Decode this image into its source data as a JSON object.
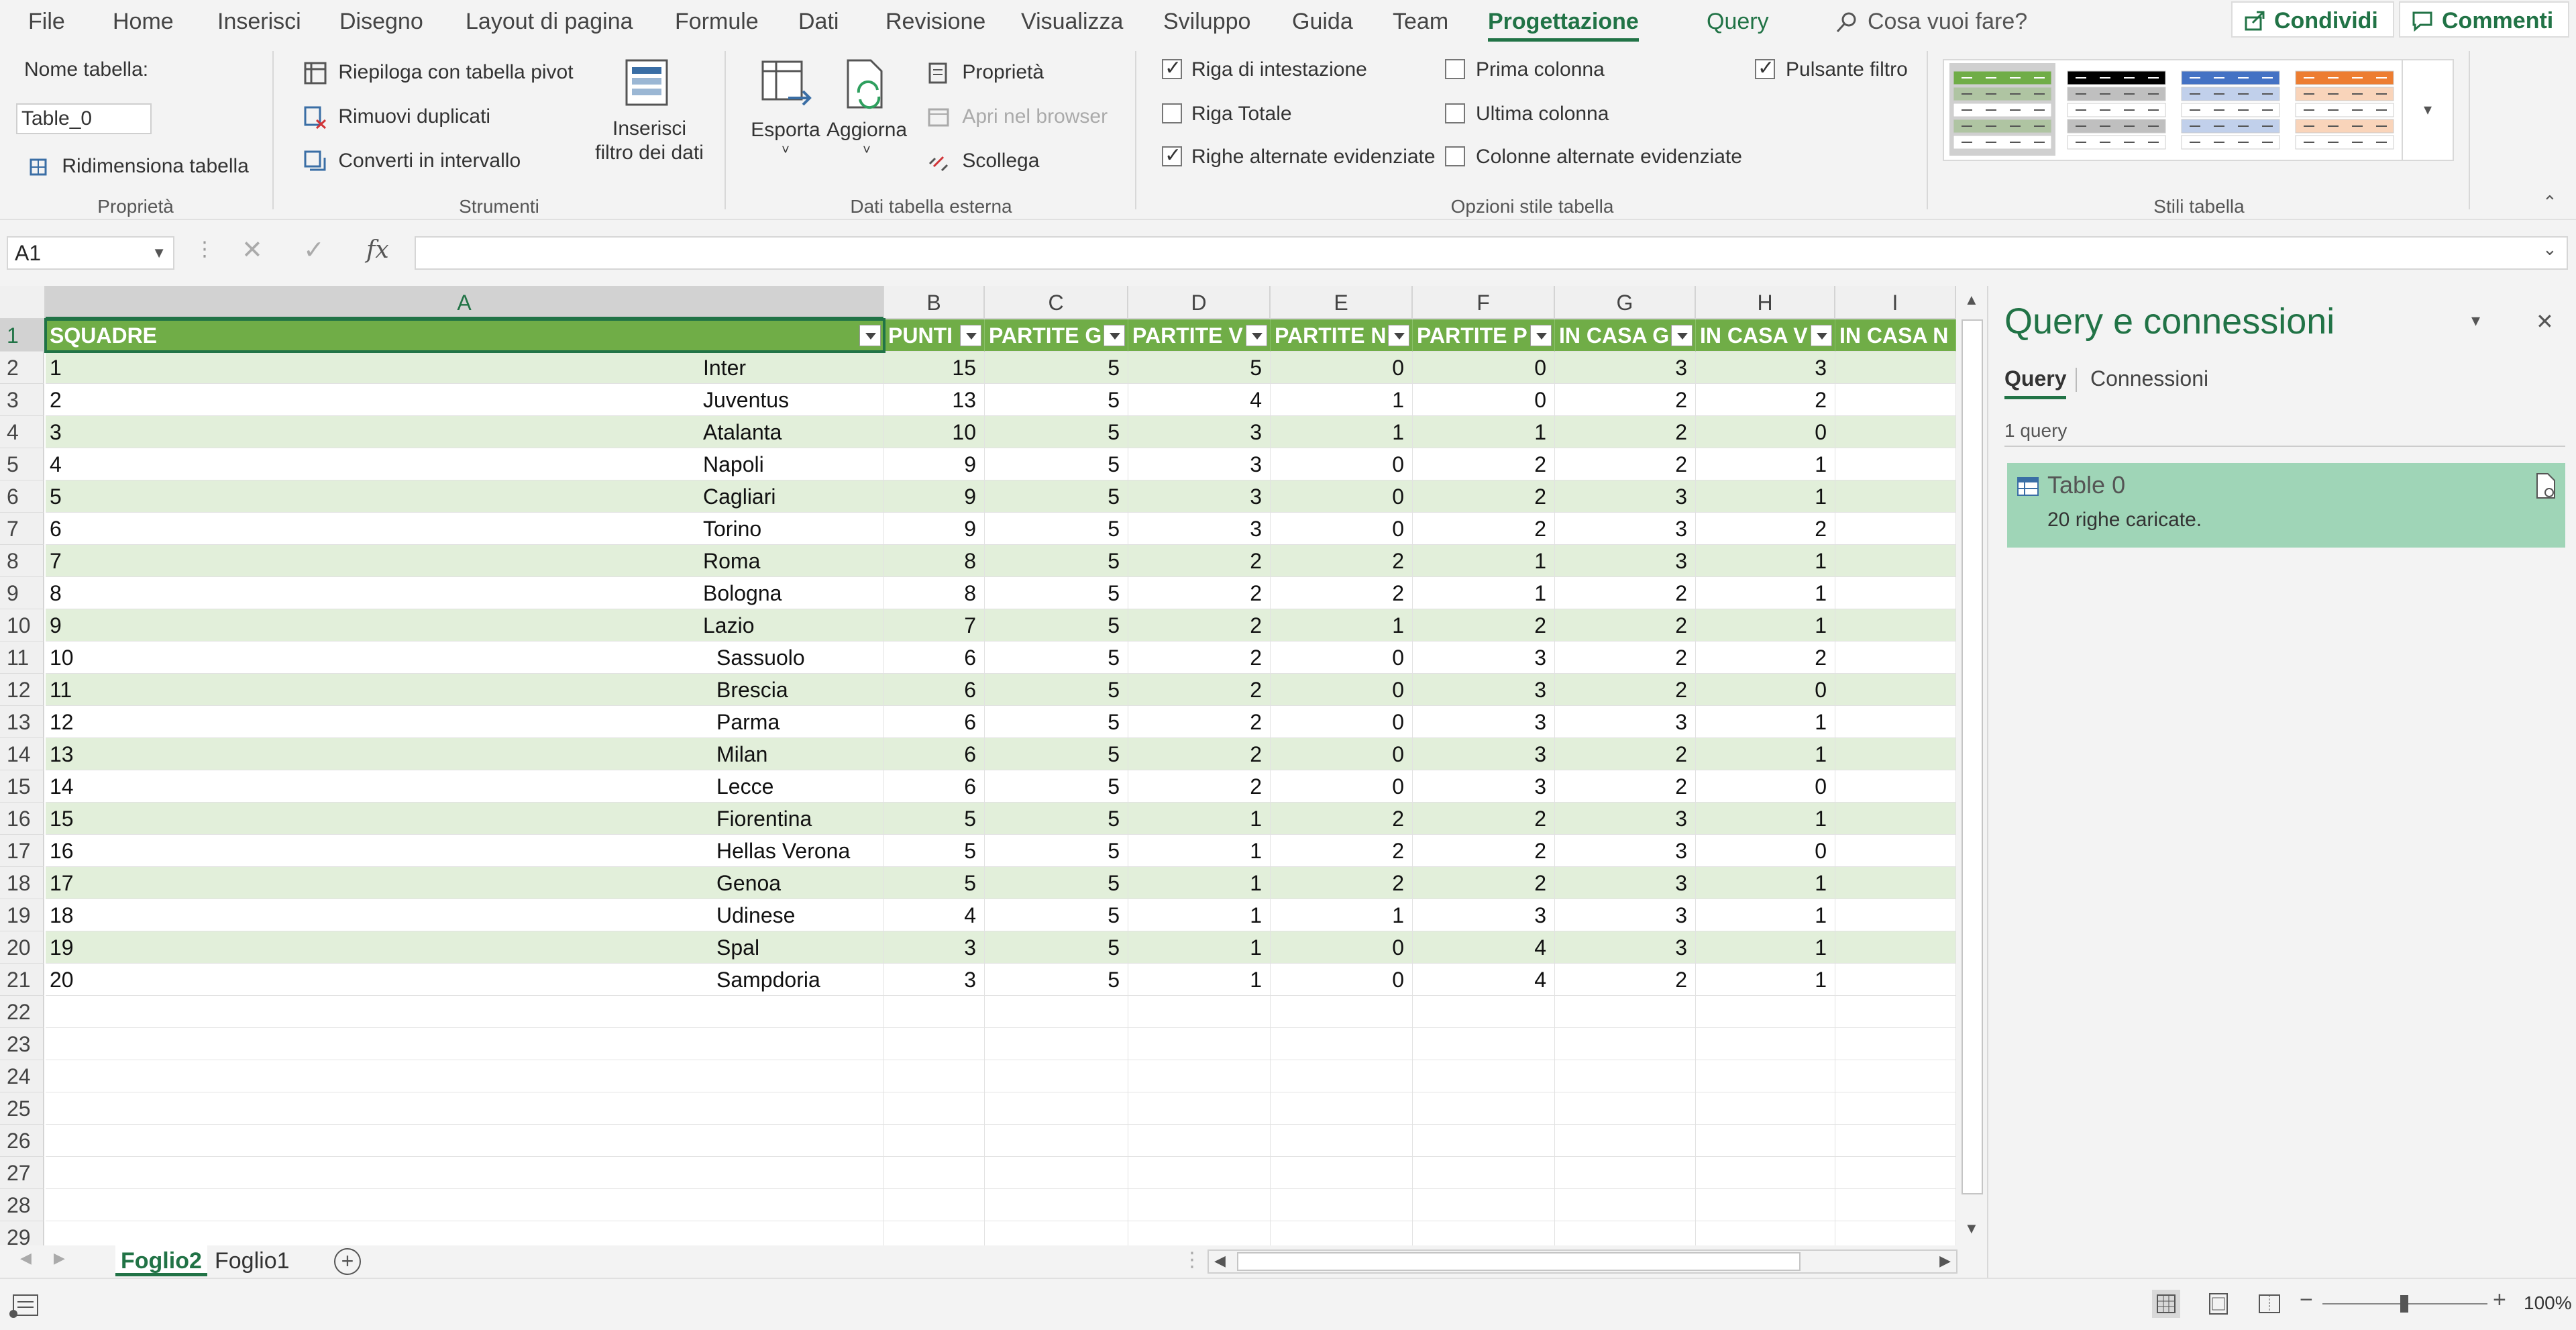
{
  "menu": {
    "items": [
      "File",
      "Home",
      "Inserisci",
      "Disegno",
      "Layout di pagina",
      "Formule",
      "Dati",
      "Revisione",
      "Visualizza",
      "Sviluppo",
      "Guida",
      "Team",
      "Progettazione",
      "Query"
    ],
    "search_placeholder": "Cosa vuoi fare?",
    "share_label": "Condividi",
    "comments_label": "Commenti"
  },
  "ribbon": {
    "properties": {
      "table_name_label": "Nome tabella:",
      "table_name_value": "Table_0",
      "resize_label": "Ridimensiona tabella",
      "group_label": "Proprietà"
    },
    "tools": {
      "pivot_label": "Riepiloga con tabella pivot",
      "remove_dup_label": "Rimuovi duplicati",
      "convert_label": "Converti in intervallo",
      "slicer_label_1": "Inserisci",
      "slicer_label_2": "filtro dei dati",
      "group_label": "Strumenti"
    },
    "external": {
      "export_label": "Esporta",
      "refresh_label": "Aggiorna",
      "props_label": "Proprietà",
      "open_browser_label": "Apri nel browser",
      "unlink_label": "Scollega",
      "group_label": "Dati tabella esterna"
    },
    "style_options": {
      "header_row": "Riga di intestazione",
      "total_row": "Riga Totale",
      "banded_rows": "Righe alternate evidenziate",
      "first_column": "Prima colonna",
      "last_column": "Ultima colonna",
      "banded_columns": "Colonne alternate evidenziate",
      "filter_button": "Pulsante filtro",
      "header_row_checked": true,
      "total_row_checked": false,
      "banded_rows_checked": true,
      "first_column_checked": false,
      "last_column_checked": false,
      "banded_columns_checked": false,
      "filter_button_checked": true,
      "group_label": "Opzioni stile tabella"
    },
    "styles": {
      "group_label": "Stili tabella",
      "swatches": [
        "#70ad47",
        "#000000",
        "#4472c4",
        "#ed7d31"
      ]
    }
  },
  "formula_bar": {
    "name_box": "A1",
    "fx_label": "fx",
    "value": ""
  },
  "grid": {
    "columns": [
      "A",
      "B",
      "C",
      "D",
      "E",
      "F",
      "G",
      "H",
      "I"
    ],
    "headers": [
      "SQUADRE",
      "PUNTI",
      "PARTITE G",
      "PARTITE V",
      "PARTITE N",
      "PARTITE P",
      "IN CASA G",
      "IN CASA V",
      "IN CASA N"
    ],
    "rows": [
      [
        "1",
        "Inter",
        "15",
        "5",
        "5",
        "0",
        "0",
        "3",
        "3"
      ],
      [
        "2",
        "Juventus",
        "13",
        "5",
        "4",
        "1",
        "0",
        "2",
        "2"
      ],
      [
        "3",
        "Atalanta",
        "10",
        "5",
        "3",
        "1",
        "1",
        "2",
        "0"
      ],
      [
        "4",
        "Napoli",
        "9",
        "5",
        "3",
        "0",
        "2",
        "2",
        "1"
      ],
      [
        "5",
        "Cagliari",
        "9",
        "5",
        "3",
        "0",
        "2",
        "3",
        "1"
      ],
      [
        "6",
        "Torino",
        "9",
        "5",
        "3",
        "0",
        "2",
        "3",
        "2"
      ],
      [
        "7",
        "Roma",
        "8",
        "5",
        "2",
        "2",
        "1",
        "3",
        "1"
      ],
      [
        "8",
        "Bologna",
        "8",
        "5",
        "2",
        "2",
        "1",
        "2",
        "1"
      ],
      [
        "9",
        "Lazio",
        "7",
        "5",
        "2",
        "1",
        "2",
        "2",
        "1"
      ],
      [
        "10",
        "Sassuolo",
        "6",
        "5",
        "2",
        "0",
        "3",
        "2",
        "2"
      ],
      [
        "11",
        "Brescia",
        "6",
        "5",
        "2",
        "0",
        "3",
        "2",
        "0"
      ],
      [
        "12",
        "Parma",
        "6",
        "5",
        "2",
        "0",
        "3",
        "3",
        "1"
      ],
      [
        "13",
        "Milan",
        "6",
        "5",
        "2",
        "0",
        "3",
        "2",
        "1"
      ],
      [
        "14",
        "Lecce",
        "6",
        "5",
        "2",
        "0",
        "3",
        "2",
        "0"
      ],
      [
        "15",
        "Fiorentina",
        "5",
        "5",
        "1",
        "2",
        "2",
        "3",
        "1"
      ],
      [
        "16",
        "Hellas Verona",
        "5",
        "5",
        "1",
        "2",
        "2",
        "3",
        "0"
      ],
      [
        "17",
        "Genoa",
        "5",
        "5",
        "1",
        "2",
        "2",
        "3",
        "1"
      ],
      [
        "18",
        "Udinese",
        "4",
        "5",
        "1",
        "1",
        "3",
        "3",
        "1"
      ],
      [
        "19",
        "Spal",
        "3",
        "5",
        "1",
        "0",
        "4",
        "3",
        "1"
      ],
      [
        "20",
        "Sampdoria",
        "3",
        "5",
        "1",
        "0",
        "4",
        "2",
        "1"
      ]
    ],
    "row_numbers": [
      "1",
      "2",
      "3",
      "4",
      "5",
      "6",
      "7",
      "8",
      "9",
      "10",
      "11",
      "12",
      "13",
      "14",
      "15",
      "16",
      "17",
      "18",
      "19",
      "20",
      "21",
      "22",
      "23",
      "24",
      "25",
      "26",
      "27",
      "28",
      "29"
    ]
  },
  "sheets": {
    "tabs": [
      "Foglio2",
      "Foglio1"
    ],
    "active": "Foglio2"
  },
  "pane": {
    "title": "Query e connessioni",
    "tab_query": "Query",
    "tab_connections": "Connessioni",
    "count": "1 query",
    "item_name": "Table 0",
    "item_status": "20 righe caricate."
  },
  "status": {
    "zoom": "100%"
  },
  "colors": {
    "accent": "#217346",
    "table_header": "#70ad47",
    "table_band": "#e2efda",
    "query_card": "#9fd5b7"
  }
}
